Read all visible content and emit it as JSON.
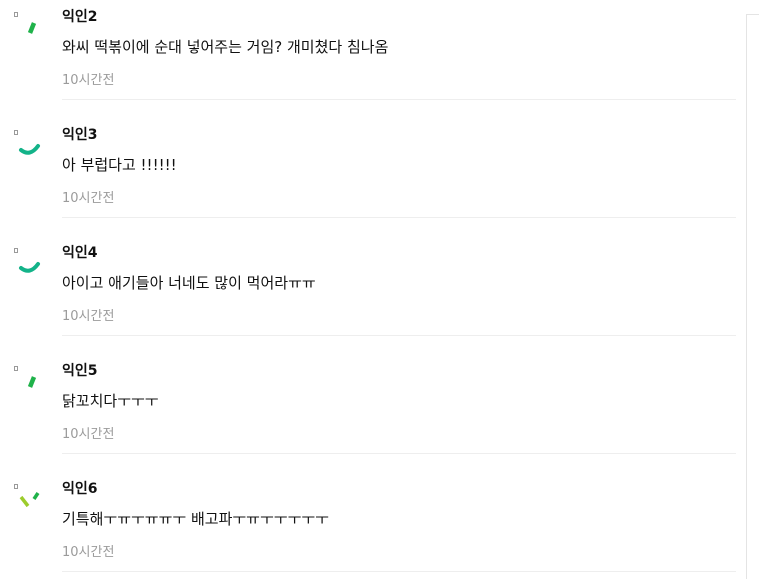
{
  "comments": [
    {
      "author": "익인2",
      "text": "와씨 떡볶이에 순대 넣어주는 거임? 개미쳤다 침나옴",
      "time": "10시간전",
      "avatar_icon": "green-dash-icon",
      "avatar_color": "#1fb24a"
    },
    {
      "author": "익인3",
      "text": "아 부럽다고 !!!!!!",
      "time": "10시간전",
      "avatar_icon": "teal-arc-icon",
      "avatar_color": "#13b389"
    },
    {
      "author": "익인4",
      "text": "아이고 애기들아 너네도 많이 먹어라ㅠㅠ",
      "time": "10시간전",
      "avatar_icon": "teal-arc-icon",
      "avatar_color": "#13b389"
    },
    {
      "author": "익인5",
      "text": "닭꼬치다ㅜㅜㅜ",
      "time": "10시간전",
      "avatar_icon": "green-dash-icon",
      "avatar_color": "#1fb24a"
    },
    {
      "author": "익인6",
      "text": "기특해ㅜㅠㅜㅠㅠㅜ 배고파ㅜㅠㅜㅜㅜㅜㅜ",
      "time": "10시간전",
      "avatar_icon": "lime-check-icon",
      "avatar_color": "#9ccc2c"
    }
  ]
}
